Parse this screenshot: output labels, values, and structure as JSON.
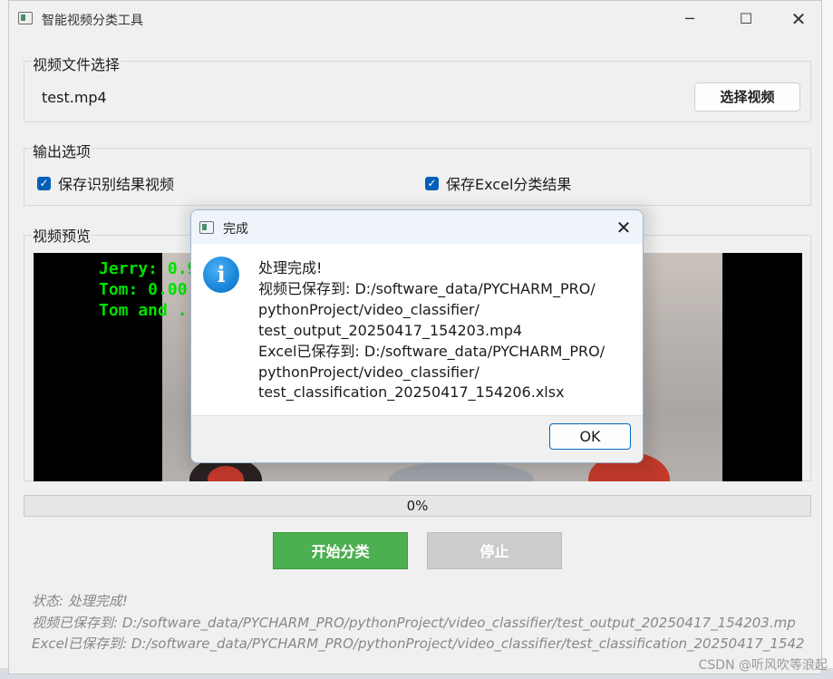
{
  "window": {
    "title": "智能视频分类工具",
    "controls": {
      "minimize": "─",
      "maximize": "☐",
      "close": "✕"
    }
  },
  "file_section": {
    "title": "视频文件选择",
    "filename": "test.mp4",
    "choose_button": "选择视频"
  },
  "output_section": {
    "title": "输出选项",
    "options": [
      {
        "label": "保存识别结果视频",
        "checked": true
      },
      {
        "label": "保存Excel分类结果",
        "checked": true
      }
    ]
  },
  "preview_section": {
    "title": "视频预览",
    "overlay_lines": [
      "Jerry: 0.99",
      "Tom: 0.00",
      "Tom and ..."
    ]
  },
  "progress": {
    "value": 0,
    "text": "0%"
  },
  "buttons": {
    "start": "开始分类",
    "stop": "停止"
  },
  "status": {
    "line1": "状态: 处理完成!",
    "line2": "视频已保存到: D:/software_data/PYCHARM_PRO/pythonProject/video_classifier/test_output_20250417_154203.mp",
    "line3": "Excel已保存到: D:/software_data/PYCHARM_PRO/pythonProject/video_classifier/test_classification_20250417_1542"
  },
  "dialog": {
    "title": "完成",
    "icon": "info-icon",
    "message_lines": [
      "处理完成!",
      "视频已保存到: D:/software_data/PYCHARM_PRO/",
      "pythonProject/video_classifier/",
      "test_output_20250417_154203.mp4",
      "Excel已保存到: D:/software_data/PYCHARM_PRO/",
      "pythonProject/video_classifier/",
      "test_classification_20250417_154206.xlsx"
    ],
    "ok_button": "OK",
    "close": "✕"
  },
  "watermark": "CSDN @听风吹等浪起",
  "colors": {
    "start_button": "#4caf50",
    "stop_button": "#cccccc",
    "checkbox": "#005fb8",
    "overlay_text": "#00e000"
  }
}
